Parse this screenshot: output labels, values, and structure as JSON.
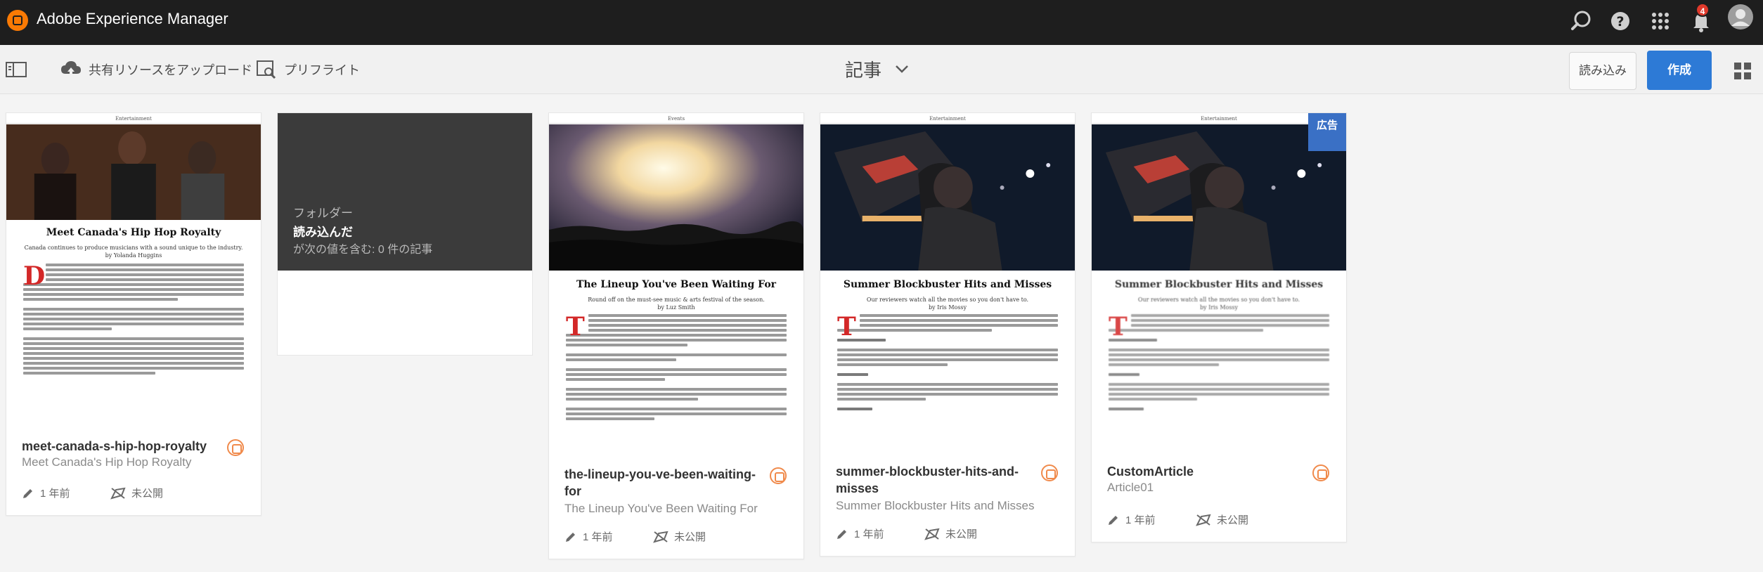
{
  "shell": {
    "title": "Adobe Experience Manager",
    "notification_count": "4",
    "icons": [
      "search-icon",
      "help-icon",
      "solutions-icon",
      "bell-icon",
      "user-avatar"
    ]
  },
  "actionbar": {
    "rail_toggle_icon": "rail-toggle-icon",
    "upload_label": "共有リソースをアップロード",
    "preflight_label": "プリフライト",
    "page_title": "記事",
    "import_label": "読み込み",
    "create_label": "作成",
    "view_icon": "grid-view-icon"
  },
  "folder": {
    "type_label": "フォルダー",
    "name": "読み込んだ",
    "desc": "が次の値を含む: 0 件の記事"
  },
  "cards": [
    {
      "name": "meet-canada-s-hip-hop-royalty",
      "subtitle": "Meet Canada's Hip Hop Royalty",
      "modified": "1 年前",
      "status": "未公開",
      "tag": "Entertainment",
      "article_title": "Meet Canada's Hip Hop Royalty",
      "article_sub": "Canada continues to produce musicians with a sound unique to the industry.",
      "article_author": "by Yolanda Huggins",
      "dropcap": "D"
    },
    {
      "name": "the-lineup-you-ve-been-waiting-for",
      "subtitle": "The Lineup You've Been Waiting For",
      "modified": "1 年前",
      "status": "未公開",
      "tag": "Events",
      "article_title": "The Lineup You've Been Waiting For",
      "article_sub": "Round off on the must-see music & arts festival of the season.",
      "article_author": "by Luz Smith",
      "dropcap": "T"
    },
    {
      "name": "summer-blockbuster-hits-and-misses",
      "subtitle": "Summer Blockbuster Hits and Misses",
      "modified": "1 年前",
      "status": "未公開",
      "tag": "Entertainment",
      "article_title": "Summer Blockbuster Hits and Misses",
      "article_sub": "Our reviewers watch all the movies so you don't have to.",
      "article_author": "by Iris Mossy",
      "dropcap": "T"
    },
    {
      "name": "CustomArticle",
      "subtitle": "Article01",
      "modified": "1 年前",
      "status": "未公開",
      "tag": "Entertainment",
      "article_title": "Summer Blockbuster Hits and Misses",
      "article_sub": "Our reviewers watch all the movies so you don't have to.",
      "article_author": "by Iris Mossy",
      "dropcap": "T",
      "badge": "広告"
    }
  ],
  "colors": {
    "shell_bg": "#1e1e1e",
    "accent": "#2d7ad6",
    "badge": "#3a70c5",
    "status_orange": "#f08a4b"
  }
}
